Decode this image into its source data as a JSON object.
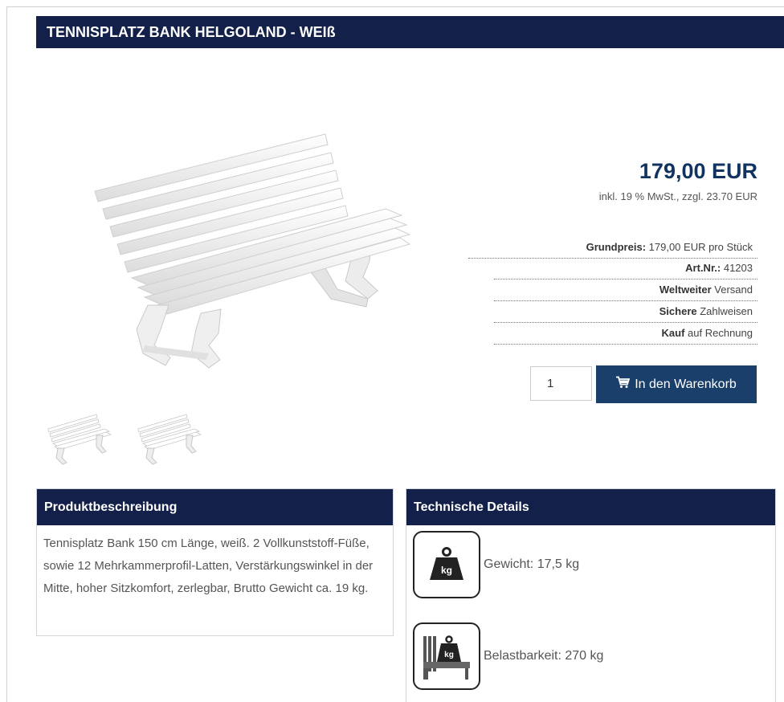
{
  "product": {
    "title": "TENNISPLATZ BANK HELGOLAND - WEIß",
    "price": "179,00 EUR",
    "tax_note": "inkl. 19 % MwSt., zzgl. 23.70 EUR"
  },
  "info_rows": [
    {
      "bold": "Grundpreis:",
      "text": " 179,00 EUR pro Stück"
    },
    {
      "bold": "Art.Nr.:",
      "text": " 41203"
    },
    {
      "bold": "Weltweiter",
      "text": " Versand"
    },
    {
      "bold": "Sichere",
      "text": " Zahlweisen"
    },
    {
      "bold": "Kauf",
      "text": " auf Rechnung"
    }
  ],
  "cart": {
    "quantity": "1",
    "button_label": "In den Warenkorb",
    "icon": "shopping-cart-icon"
  },
  "description": {
    "heading": "Produktbeschreibung",
    "text": "Tennisplatz Bank 150 cm Länge, weiß. 2 Vollkunststoff-Füße, sowie 12 Mehrkammerprofil-Latten, Verstärkungswinkel in der Mitte, hoher Sitzkomfort, zerlegbar, Brutto Gewicht ca. 19 kg."
  },
  "technical": {
    "heading": "Technische Details",
    "items": [
      {
        "label": "Gewicht: 17,5 kg",
        "icon": "weight-icon",
        "icon_text": "kg"
      },
      {
        "label": "Belastbarkeit: 270 kg",
        "icon": "load-capacity-icon",
        "icon_text": "kg"
      }
    ]
  },
  "colors": {
    "header_navy": "#12204a",
    "price_blue": "#10345f",
    "button_blue": "#1a3f6b"
  }
}
